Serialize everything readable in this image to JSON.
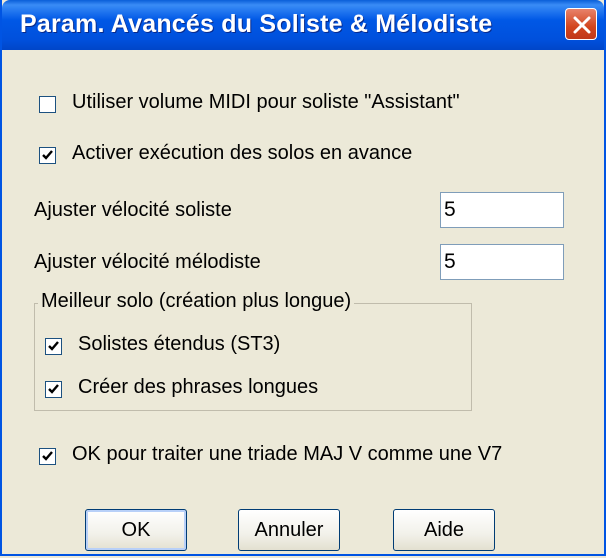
{
  "window": {
    "title": "Param. Avancés du Soliste & Mélodiste"
  },
  "options": {
    "midi_volume": {
      "label": "Utiliser volume MIDI pour soliste \"Assistant\"",
      "checked": false
    },
    "advance_solos": {
      "label": "Activer exécution des solos en avance",
      "checked": true
    },
    "ok_triad": {
      "label": "OK pour traiter une triade MAJ V comme une V7",
      "checked": true
    }
  },
  "fields": {
    "soloist_velocity": {
      "label": "Ajuster vélocité soliste",
      "value": "5"
    },
    "melodist_velocity": {
      "label": "Ajuster vélocité mélodiste",
      "value": "5"
    }
  },
  "group": {
    "title": "Meilleur solo (création plus longue)",
    "extended_soloists": {
      "label": "Solistes étendus (ST3)",
      "checked": true
    },
    "long_phrases": {
      "label": "Créer des phrases longues",
      "checked": true
    }
  },
  "buttons": {
    "ok": "OK",
    "cancel": "Annuler",
    "help": "Aide"
  },
  "colors": {
    "title_bar": "#0054e3",
    "dialog_bg": "#ece9d8",
    "close_button": "#d2451e"
  }
}
